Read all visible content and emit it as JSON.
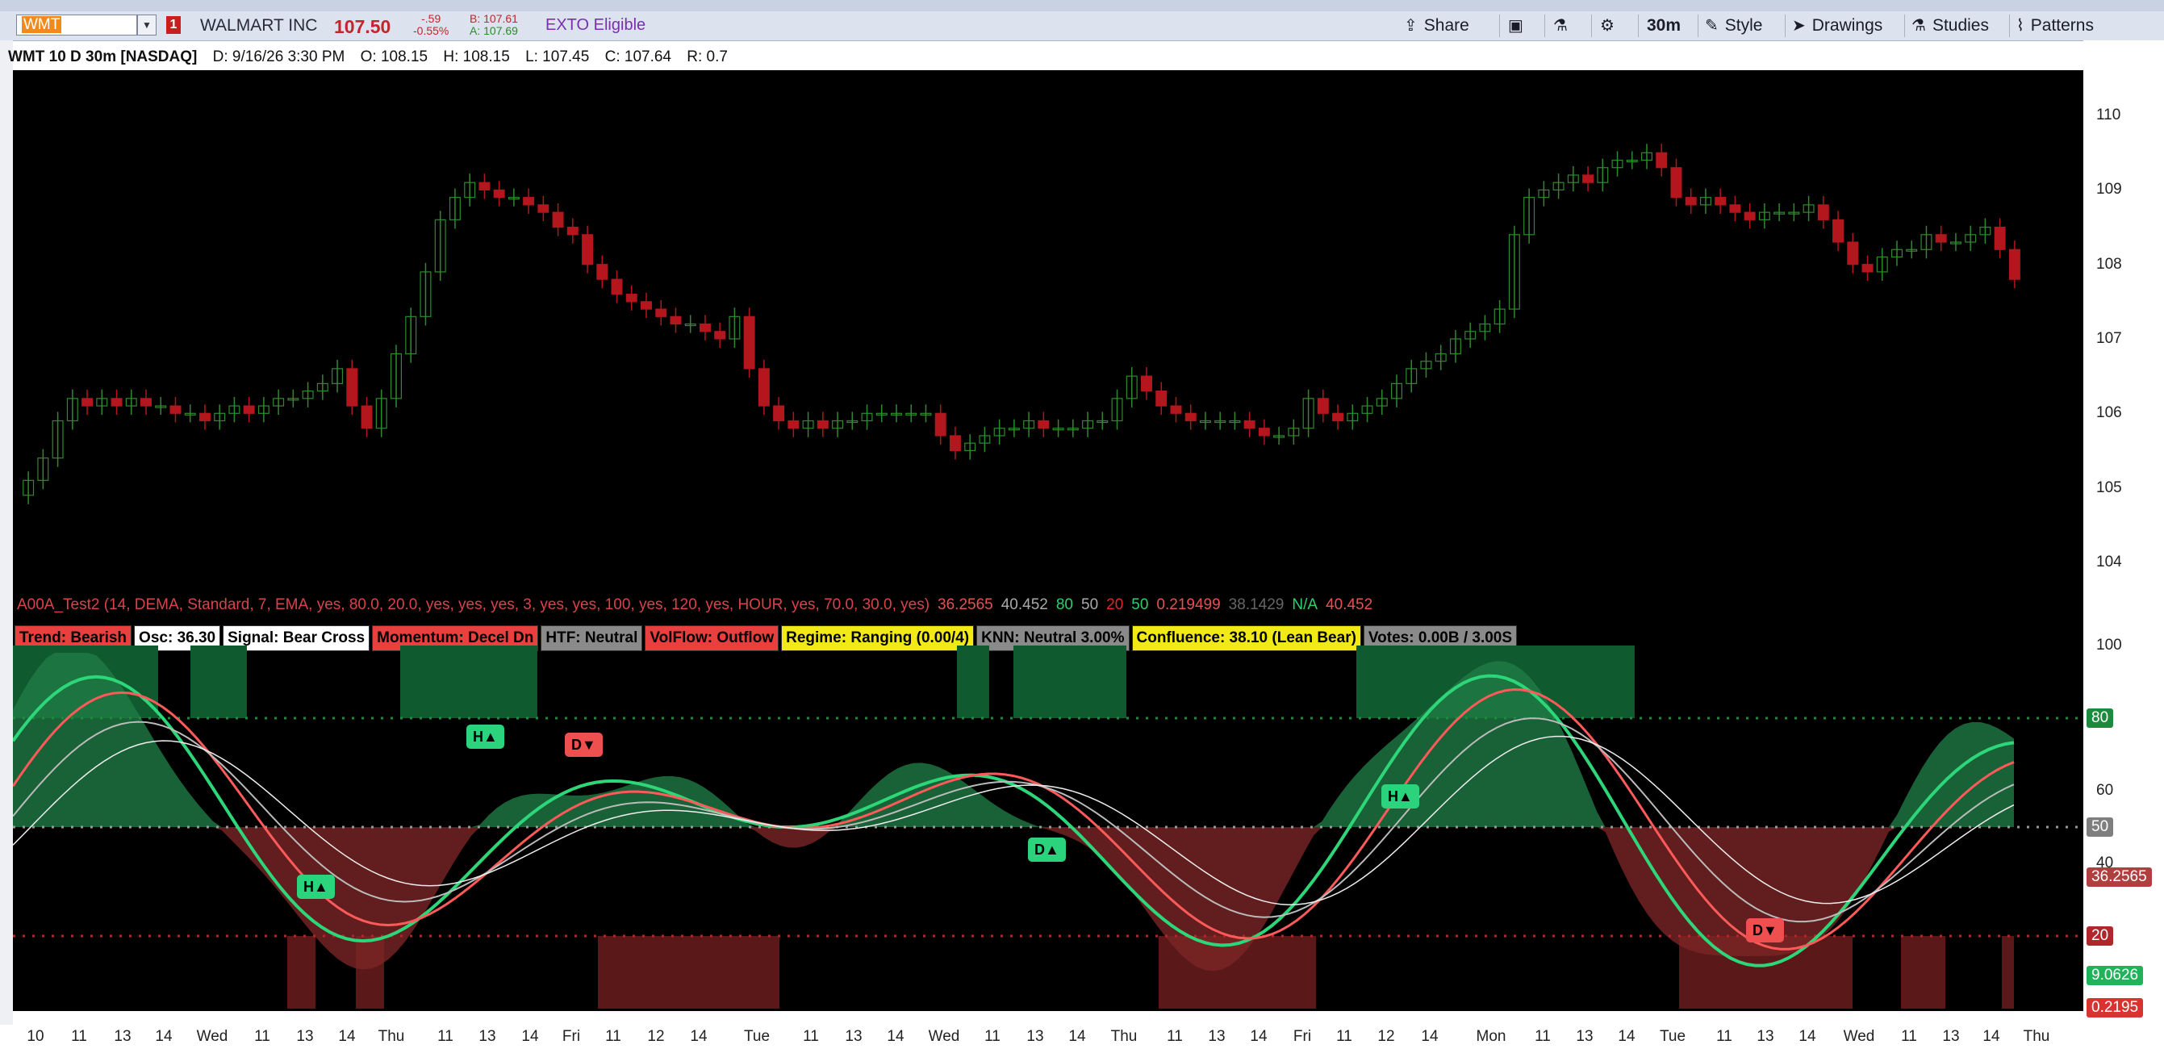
{
  "toolbar": {
    "symbol": "WMT",
    "alert_badge": "1",
    "company_name": "WALMART INC",
    "last_price": "107.50",
    "net_change": "-.59",
    "pct_change": "-0.55%",
    "bid": "B: 107.61",
    "ask": "A: 107.69",
    "exto": "EXTO Eligible",
    "share": "Share",
    "timeframe": "30m",
    "style": "Style",
    "drawings": "Drawings",
    "studies": "Studies",
    "patterns": "Patterns"
  },
  "infobar": {
    "title": "WMT 10 D 30m [NASDAQ]",
    "date": "D: 9/16/26 3:30 PM",
    "open": "O: 108.15",
    "high": "H: 108.15",
    "low": "L: 107.45",
    "close": "C: 107.64",
    "range": "R: 0.7"
  },
  "study": {
    "name": "A00A_Test2 (14, DEMA, Standard, 7, EMA, yes, 80.0, 20.0, yes, yes, yes, 3, yes, yes, 100, yes, 120, yes, HOUR, yes, 70.0, 30.0, yes)",
    "v1": "36.2565",
    "v2": "40.452",
    "v3": "80",
    "v4": "50",
    "v5": "20",
    "v6": "50",
    "v7": "0.219499",
    "v8": "38.1429",
    "v9": "N/A",
    "v10": "40.452"
  },
  "badges": [
    {
      "text": "Trend: Bearish",
      "bg": "#e8403e",
      "fg": "#000000"
    },
    {
      "text": "Osc: 36.30",
      "bg": "#ffffff",
      "fg": "#000000"
    },
    {
      "text": "Signal: Bear Cross",
      "bg": "#ffffff",
      "fg": "#000000"
    },
    {
      "text": "Momentum: Decel Dn",
      "bg": "#e8403e",
      "fg": "#000000"
    },
    {
      "text": "HTF: Neutral",
      "bg": "#8a8a8a",
      "fg": "#000000"
    },
    {
      "text": "VolFlow: Outflow",
      "bg": "#e8403e",
      "fg": "#000000"
    },
    {
      "text": "Regime: Ranging (0.00/4)",
      "bg": "#f2ea16",
      "fg": "#000000"
    },
    {
      "text": "KNN: Neutral 3.00%",
      "bg": "#8a8a8a",
      "fg": "#000000"
    },
    {
      "text": "Confluence: 38.10 (Lean Bear)",
      "bg": "#f2ea16",
      "fg": "#000000"
    },
    {
      "text": "Votes: 0.00B / 3.00S",
      "bg": "#8a8a8a",
      "fg": "#000000"
    }
  ],
  "price_axis": [
    "110",
    "109",
    "108",
    "107",
    "106",
    "105",
    "104"
  ],
  "osc_axis": [
    "100",
    "80",
    "60",
    "50",
    "40",
    "20"
  ],
  "osc_tags": [
    {
      "text": "80",
      "bg": "#1c8b3c"
    },
    {
      "text": "50",
      "bg": "#7f7f7f"
    },
    {
      "text": "36.2565",
      "bg": "#b0403f"
    },
    {
      "text": "20",
      "bg": "#b0262a"
    },
    {
      "text": "9.0626",
      "bg": "#21b35a"
    },
    {
      "text": "0.2195",
      "bg": "#d9332f"
    }
  ],
  "xaxis": [
    "10",
    "11",
    "13",
    "14",
    "Wed",
    "11",
    "13",
    "14",
    "Thu",
    "11",
    "13",
    "14",
    "Fri",
    "11",
    "12",
    "14",
    "Tue",
    "11",
    "13",
    "14",
    "Wed",
    "11",
    "13",
    "14",
    "Thu",
    "11",
    "13",
    "14",
    "Fri",
    "11",
    "12",
    "14",
    "Mon",
    "11",
    "13",
    "14",
    "Tue",
    "11",
    "13",
    "14",
    "Wed",
    "11",
    "13",
    "14",
    "Thu"
  ],
  "markers": [
    {
      "text": "H▲",
      "bg": "#2bd47c"
    },
    {
      "text": "H▲",
      "bg": "#2bd47c"
    },
    {
      "text": "D▼",
      "bg": "#ee4f4f"
    },
    {
      "text": "D▲",
      "bg": "#2bd47c"
    },
    {
      "text": "H▲",
      "bg": "#2bd47c"
    },
    {
      "text": "D▼",
      "bg": "#ee4f4f"
    }
  ],
  "chart_data": {
    "type": "candlestick",
    "closes": [
      105.1,
      105.4,
      105.9,
      106.2,
      106.1,
      106.2,
      106.1,
      106.2,
      106.1,
      106.1,
      106.0,
      106.0,
      105.9,
      106.0,
      106.1,
      106.0,
      106.1,
      106.2,
      106.2,
      106.3,
      106.4,
      106.6,
      106.1,
      105.8,
      106.2,
      106.8,
      107.3,
      107.9,
      108.6,
      108.9,
      109.1,
      109.0,
      108.9,
      108.9,
      108.8,
      108.7,
      108.5,
      108.4,
      108.0,
      107.8,
      107.6,
      107.5,
      107.4,
      107.3,
      107.2,
      107.2,
      107.1,
      107.0,
      107.3,
      106.6,
      106.1,
      105.9,
      105.8,
      105.9,
      105.8,
      105.9,
      105.9,
      106.0,
      106.0,
      106.0,
      106.0,
      106.0,
      105.7,
      105.5,
      105.6,
      105.7,
      105.8,
      105.8,
      105.9,
      105.8,
      105.8,
      105.8,
      105.9,
      105.9,
      106.2,
      106.5,
      106.3,
      106.1,
      106.0,
      105.9,
      105.9,
      105.9,
      105.9,
      105.8,
      105.7,
      105.7,
      105.8,
      106.2,
      106.0,
      105.9,
      106.0,
      106.1,
      106.2,
      106.4,
      106.6,
      106.7,
      106.8,
      107.0,
      107.1,
      107.2,
      107.4,
      108.4,
      108.9,
      109.0,
      109.1,
      109.2,
      109.1,
      109.3,
      109.4,
      109.4,
      109.5,
      109.3,
      108.9,
      108.8,
      108.9,
      108.8,
      108.7,
      108.6,
      108.7,
      108.7,
      108.7,
      108.8,
      108.6,
      108.3,
      108.0,
      107.9,
      108.1,
      108.2,
      108.2,
      108.4,
      108.3,
      108.3,
      108.4,
      108.5,
      108.2,
      107.8
    ],
    "ylim": [
      104,
      110.5
    ],
    "oscillator": {
      "levels": [
        80,
        50,
        20
      ],
      "ylim": [
        0,
        100
      ],
      "last": 36.2565
    }
  }
}
